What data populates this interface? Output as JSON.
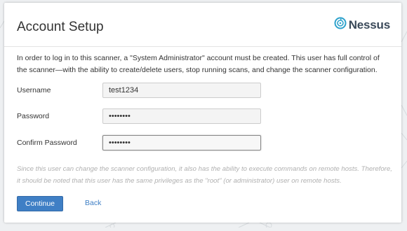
{
  "header": {
    "title": "Account Setup",
    "logo_text": "Nessus",
    "brand_color": "#3b4a5a",
    "accent_color": "#2ea2cc"
  },
  "intro": {
    "text": "In order to log in to this scanner, a \"System Administrator\" account must be created. This user has full control of the scanner—with the ability to create/delete users, stop running scans, and change the scanner configuration."
  },
  "form": {
    "username": {
      "label": "Username",
      "value": "test1234"
    },
    "password": {
      "label": "Password",
      "value": "password"
    },
    "confirm_password": {
      "label": "Confirm Password",
      "value": "password"
    }
  },
  "note": {
    "text": "Since this user can change the scanner configuration, it also has the ability to execute commands on remote hosts. Therefore, it should be noted that this user has the same privileges as the \"root\" (or administrator) user on remote hosts."
  },
  "actions": {
    "continue_label": "Continue",
    "back_label": "Back",
    "primary_color": "#3f7fc5"
  }
}
